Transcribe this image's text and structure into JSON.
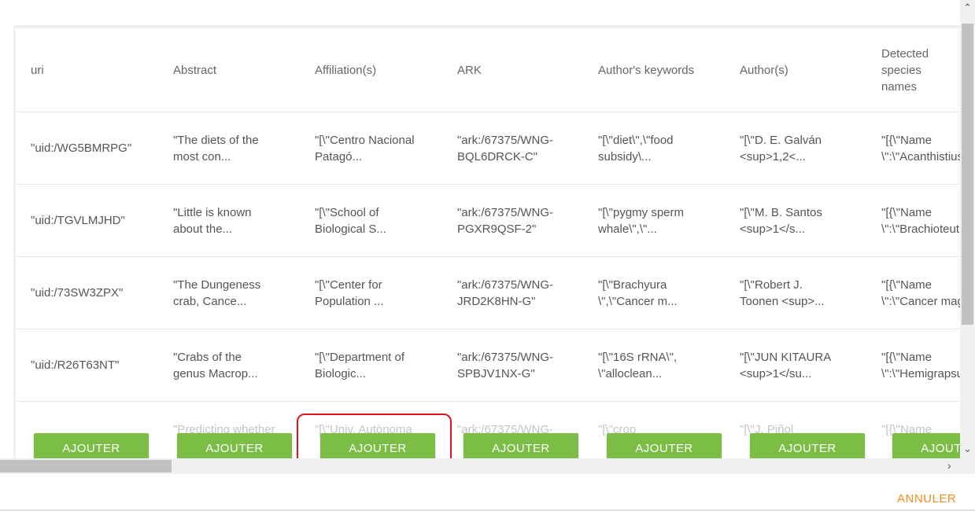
{
  "table": {
    "headers": [
      "uri",
      "Abstract",
      "Affiliation(s)",
      "ARK",
      "Author's keywords",
      "Author(s)",
      "Detected species\nnames"
    ],
    "rows": [
      [
        "\"uid:/WG5BMRPG\"",
        "\"The diets of the\nmost con...",
        "\"[\\\"Centro Nacional\nPatagó...",
        "\"ark:/67375/WNG-\nBQL6DRCK-C\"",
        "\"[\\\"diet\\\",\\\"food\nsubsidy\\...",
        "\"[\\\"D. E. Galván\n<sup>1,2<...",
        "\"[{\\\"Name\n\\\":\\\"Acanthistius"
      ],
      [
        "\"uid:/TGVLMJHD\"",
        "\"Little is known\nabout the...",
        "\"[\\\"School of\nBiological S...",
        "\"ark:/67375/WNG-\nPGXR9QSF-2\"",
        "\"[\\\"pygmy sperm\nwhale\\\",\\\"...",
        "\"[\\\"M. B. Santos\n<sup>1</s...",
        "\"[{\\\"Name\n\\\":\\\"Brachioteuthis"
      ],
      [
        "\"uid:/73SW3ZPX\"",
        "\"The Dungeness\ncrab, Cance...",
        "\"[\\\"Center for\nPopulation ...",
        "\"ark:/67375/WNG-\nJRD2K8HN-G\"",
        "\"[\\\"Brachyura\n\\\",\\\"Cancer m...",
        "\"[\\\"Robert J.\nToonen <sup>...",
        "\"[{\\\"Name\n\\\":\\\"Cancer magister"
      ],
      [
        "\"uid:/R26T63NT\"",
        "\"Crabs of the\ngenus Macrop...",
        "\"[\\\"Department of\nBiologic...",
        "\"ark:/67375/WNG-\nSPBJV1NX-G\"",
        "\"[\\\"16S rRNA\\\",\n\\\"alloclean...",
        "\"[\\\"JUN KITAURA\n<sup>1</su...",
        "\"[{\\\"Name\n\\\":\\\"Hemigrapsus"
      ]
    ],
    "partial_row": [
      "",
      "\"Predicting whether",
      "\"[\\\"Univ. Autònoma",
      "\"ark:/67375/WNG-",
      "\"[\\\"crop",
      "\"[\\\"J. Piñol",
      "\"[{\\\"Name"
    ]
  },
  "buttons": {
    "add_label": "AJOUTER",
    "cancel_label": "ANNULER"
  },
  "colors": {
    "add_button": "#7cbd45",
    "cancel": "#f28a1e",
    "highlight": "#e0141b"
  }
}
